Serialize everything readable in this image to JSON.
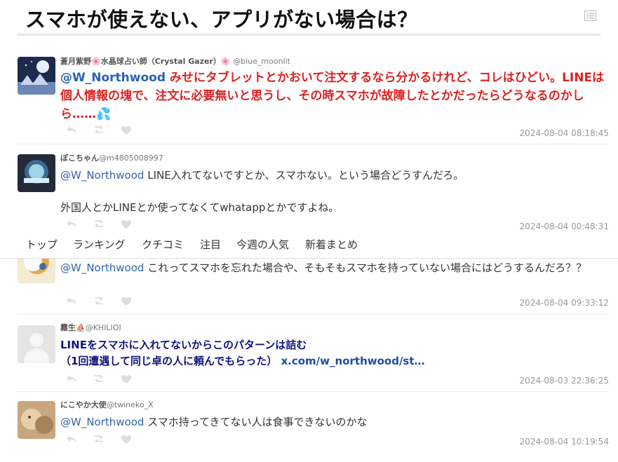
{
  "page": {
    "title": "スマホが使えない、アプリがない場合は？",
    "list_icon": "list-icon"
  },
  "nav": {
    "items": [
      {
        "label": "トップ"
      },
      {
        "label": "ランキング"
      },
      {
        "label": "クチコミ"
      },
      {
        "label": "注目"
      },
      {
        "label": "今週の人気"
      },
      {
        "label": "新着まとめ"
      }
    ]
  },
  "action_icons": [
    "reply-icon",
    "retweet-icon",
    "like-icon"
  ],
  "tweets": [
    {
      "name": "蒼月紫野🌸水晶球占い師（Crystal Gazer）🌸",
      "handle": "@blue_moonlit",
      "mention": "@W_Northwood",
      "text": " みせにタブレットとかおいて注文するなら分かるけれど、コレはひどい。LINEは個人情報の塊で、注文に必要無いと思うし、その時スマホが故障したとかだったらどうなるのかしら……💦",
      "timestamp": "2024-08-04 08:18:45",
      "style": "red"
    },
    {
      "name": "ぽこちゃん",
      "handle": "@m4805008997",
      "mention": "@W_Northwood",
      "text": " LINE入れてないですとか、スマホない。という場合どうすんだろ。",
      "text2": "外国人とかLINEとか使ってなくてwhatappとかですよね。",
      "timestamp": "2024-08-04 00:48:31"
    },
    {
      "mention": "@W_Northwood",
      "text": " これってスマホを忘れた場合や、そもそもスマホを持っていない場合にはどうするんだろ？？",
      "timestamp": "2024-08-04 09:33:12"
    },
    {
      "name": "霧生⛵",
      "handle": "@KHILIOI",
      "text": "LINEをスマホに入れてないからこのパターンは詰む",
      "text2": "（1回遭遇して同じ卓の人に頼んでもらった）",
      "link": "x.com/w_northwood/st…",
      "timestamp": "2024-08-03 22:36:25",
      "style": "navy"
    },
    {
      "name": "にこやか大使",
      "handle": "@twineko_X",
      "mention": "@W_Northwood",
      "text": " スマホ持ってきてない人は食事できないのかな",
      "timestamp": "2024-08-04 10:19:54"
    }
  ]
}
